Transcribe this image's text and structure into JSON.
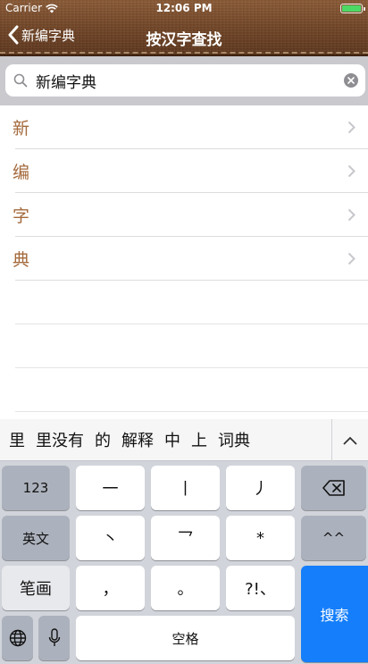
{
  "status": {
    "carrier": "Carrier",
    "time": "12:06 PM"
  },
  "nav": {
    "back_label": "新编字典",
    "title": "按汉字查找"
  },
  "search": {
    "value": "新编字典"
  },
  "list": {
    "items": [
      "新",
      "编",
      "字",
      "典"
    ]
  },
  "keyboard": {
    "candidates": [
      "里",
      "里没有",
      "的",
      "解释",
      "中",
      "上",
      "词典"
    ],
    "rows": {
      "num": "123",
      "stroke1": "一",
      "stroke2": "丨",
      "stroke3": "丿",
      "english": "英文",
      "stroke4": "丶",
      "stroke5": "乛",
      "star": "*",
      "face": "^^",
      "handwriting": "笔画",
      "comma": "，",
      "period": "。",
      "punct": "?!、",
      "space": "空格",
      "search": "搜索"
    }
  },
  "colors": {
    "accent": "#a46a3c",
    "key_blue": "#147efb"
  }
}
